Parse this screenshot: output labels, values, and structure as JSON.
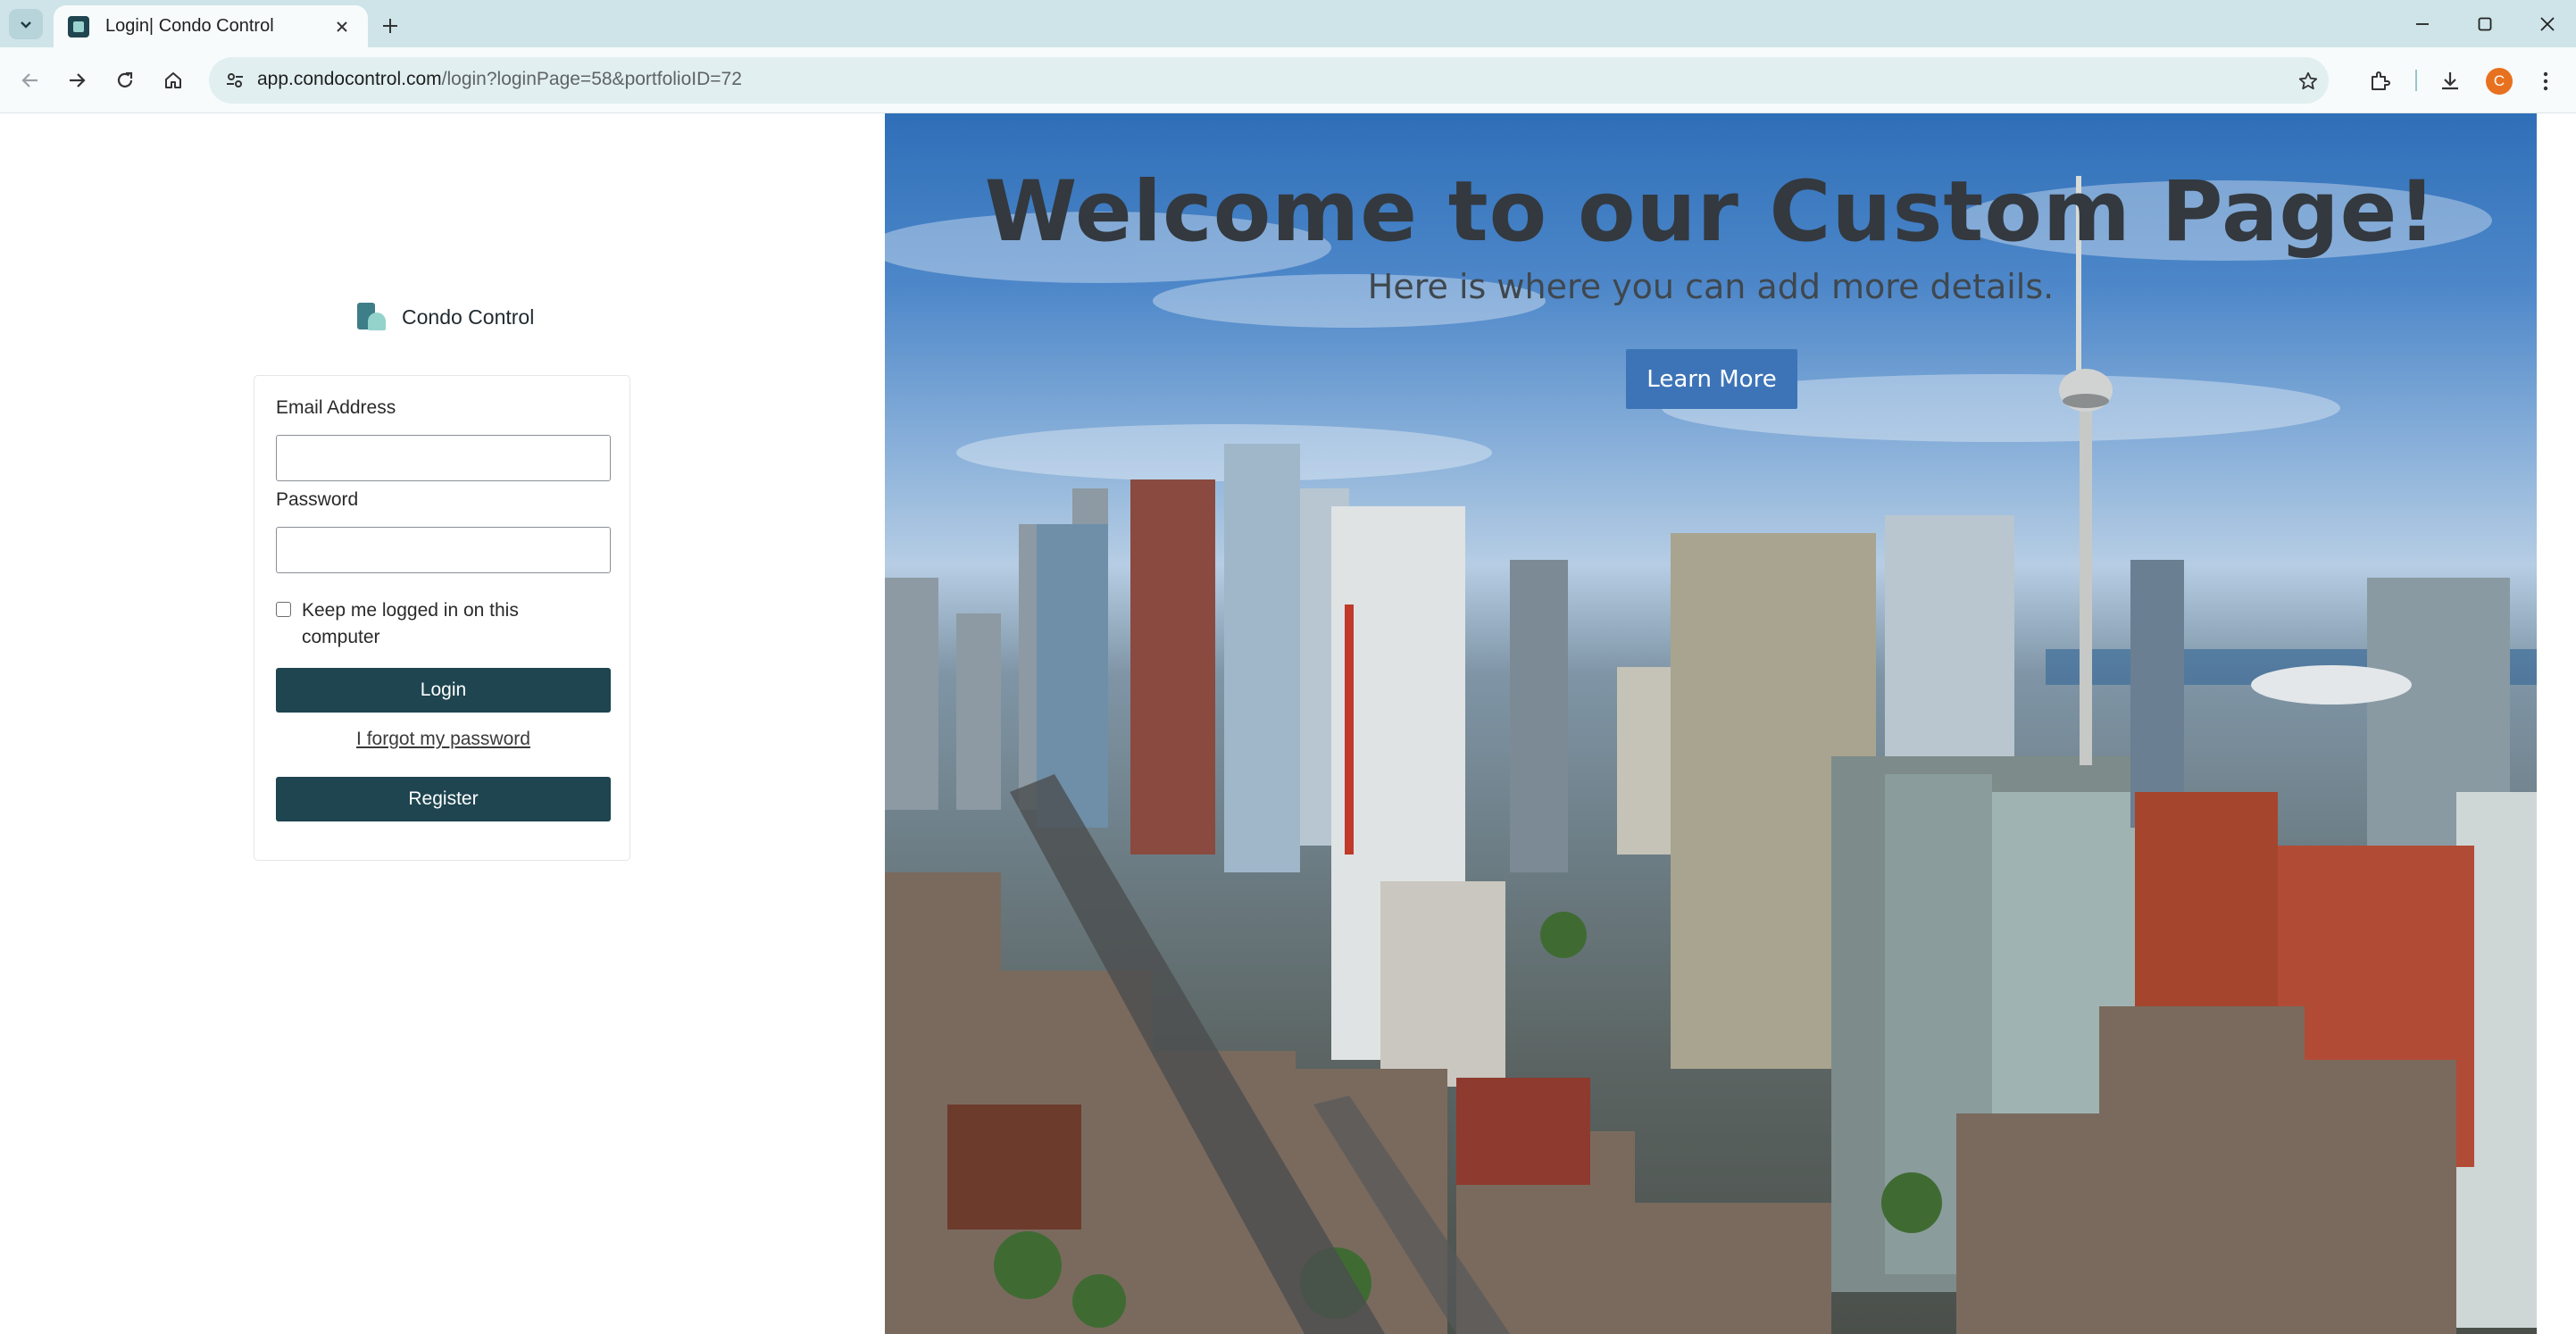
{
  "browser": {
    "tab_title": "Login| Condo Control",
    "url_host": "app.condocontrol.com",
    "url_path": "/login?loginPage=58&portfolioID=72",
    "profile_initial": "C",
    "accent_color": "#cfe4e8"
  },
  "page": {
    "brand_name": "Condo Control",
    "email_label": "Email Address",
    "email_value": "",
    "password_label": "Password",
    "password_value": "",
    "remember_label": "Keep me logged in on this computer",
    "login_label": "Login",
    "forgot_label": "I forgot my password",
    "register_label": "Register",
    "primary_color": "#1e4550"
  },
  "hero": {
    "title": "Welcome to our Custom Page!",
    "subtitle": "Here is where you can add more details.",
    "button_label": "Learn More",
    "button_color": "#3d74b7"
  }
}
